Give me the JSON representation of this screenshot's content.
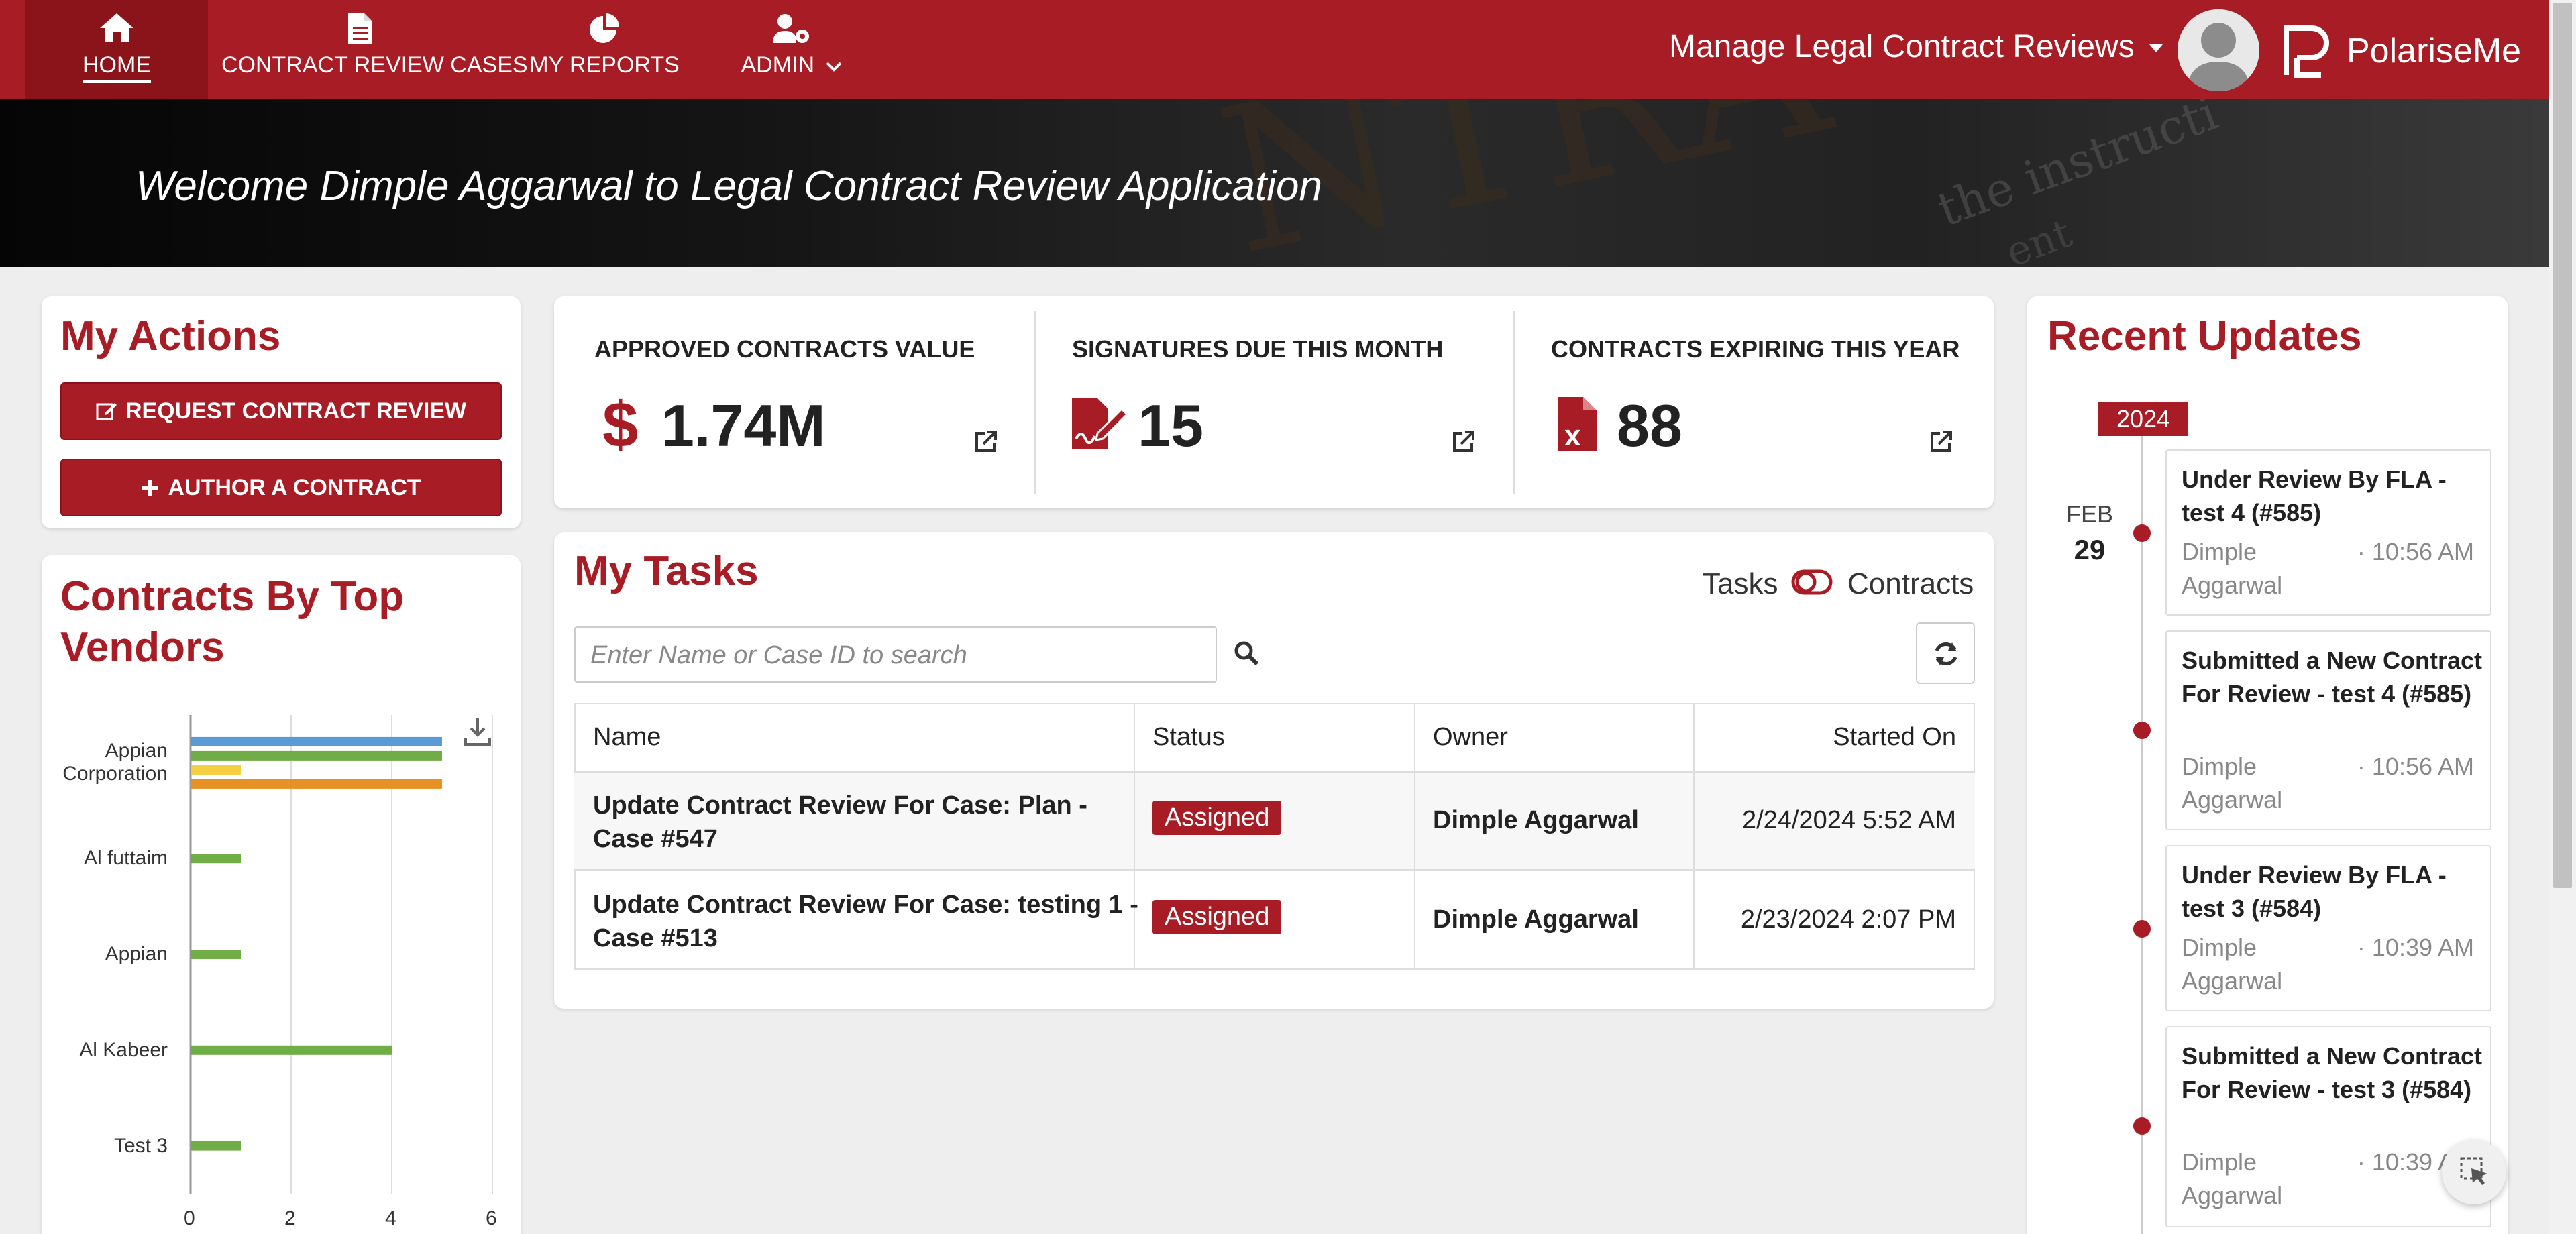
{
  "nav": {
    "items": [
      {
        "label": "HOME",
        "icon": "home-icon"
      },
      {
        "label": "CONTRACT REVIEW CASES",
        "icon": "document-icon"
      },
      {
        "label": "MY REPORTS",
        "icon": "pie-chart-icon"
      },
      {
        "label": "ADMIN",
        "icon": "user-gear-icon"
      }
    ],
    "app_switcher": "Manage Legal Contract Reviews",
    "brand": "PolariseMe"
  },
  "banner": {
    "welcome": "Welcome Dimple Aggarwal to Legal Contract Review Application"
  },
  "actions": {
    "title": "My Actions",
    "request_btn": "REQUEST CONTRACT REVIEW",
    "author_btn": "AUTHOR A CONTRACT"
  },
  "kpis": [
    {
      "label": "APPROVED CONTRACTS VALUE",
      "value": "1.74M",
      "icon": "dollar-icon"
    },
    {
      "label": "SIGNATURES DUE THIS MONTH",
      "value": "15",
      "icon": "signature-file-icon"
    },
    {
      "label": "CONTRACTS EXPIRING THIS YEAR",
      "value": "88",
      "icon": "file-excel-icon"
    }
  ],
  "tasks": {
    "title": "My Tasks",
    "toggle_left": "Tasks",
    "toggle_right": "Contracts",
    "search_placeholder": "Enter Name or Case ID to search",
    "columns": [
      "Name",
      "Status",
      "Owner",
      "Started On"
    ],
    "rows": [
      {
        "name_line1": "Update Contract Review For Case: Plan -",
        "name_line2": "Case #547",
        "status": "Assigned",
        "owner": "Dimple Aggarwal",
        "started": "2/24/2024 5:52 AM"
      },
      {
        "name_line1": "Update Contract Review For Case: testing 1 -",
        "name_line2": "Case #513",
        "status": "Assigned",
        "owner": "Dimple Aggarwal",
        "started": "2/23/2024 2:07 PM"
      }
    ]
  },
  "vendors": {
    "title_line1": "Contracts By Top",
    "title_line2": "Vendors"
  },
  "chart_data": {
    "type": "bar",
    "orientation": "horizontal",
    "categories": [
      "Appian Corporation",
      "Al futtaim",
      "Appian",
      "Al Kabeer",
      "Test 3"
    ],
    "category_lines": [
      [
        "Appian",
        "Corporation"
      ],
      [
        "Al futtaim"
      ],
      [
        "Appian"
      ],
      [
        "Al Kabeer"
      ],
      [
        "Test 3"
      ]
    ],
    "series": [
      {
        "color": "#5b9bd5",
        "values": [
          5,
          0,
          0,
          0,
          0
        ]
      },
      {
        "color": "#70ad47",
        "values": [
          5,
          1,
          1,
          4,
          1
        ]
      },
      {
        "color": "#f4d03f",
        "values": [
          1,
          0,
          0,
          0,
          0
        ]
      },
      {
        "color": "#e69124",
        "values": [
          5,
          0,
          0,
          0,
          0
        ]
      }
    ],
    "xlim": [
      0,
      6
    ],
    "xticks": [
      0,
      2,
      4,
      6
    ],
    "grid": true
  },
  "updates": {
    "title": "Recent Updates",
    "year": "2024",
    "month": "FEB",
    "day": "29",
    "items": [
      {
        "title": "Under Review By FLA - test 4 (#585)",
        "author": "Dimple Aggarwal",
        "time": "· 10:56 AM"
      },
      {
        "title": "Submitted a New Contract For Review - test 4 (#585)",
        "author": "Dimple Aggarwal",
        "time": "· 10:56 AM"
      },
      {
        "title": "Under Review By FLA - test 3 (#584)",
        "author": "Dimple Aggarwal",
        "time": "· 10:39 AM"
      },
      {
        "title": "Submitted a New Contract For Review - test 3 (#584)",
        "author": "Dimple Aggarwal",
        "time": "· 10:39 AM"
      }
    ]
  }
}
